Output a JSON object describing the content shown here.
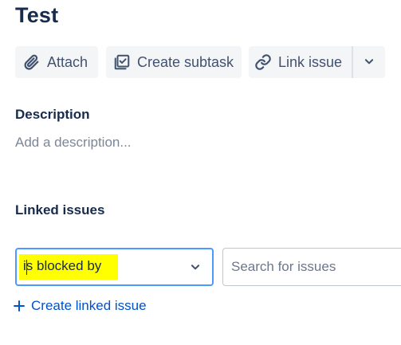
{
  "issue": {
    "title": "Test"
  },
  "toolbar": {
    "attach_label": "Attach",
    "create_subtask_label": "Create subtask",
    "link_issue_label": "Link issue"
  },
  "description": {
    "heading": "Description",
    "placeholder": "Add a description..."
  },
  "linked_issues": {
    "heading": "Linked issues",
    "relation_selected": "is blocked by",
    "search_placeholder": "Search for issues",
    "create_label": "Create linked issue"
  },
  "colors": {
    "accent": "#0052cc",
    "highlight": "#ffff00",
    "focus_border": "#4c9aff",
    "button_bg": "#f4f5f7"
  },
  "icons": [
    "paperclip-icon",
    "subtask-icon",
    "link-icon",
    "chevron-down-icon",
    "plus-icon"
  ]
}
